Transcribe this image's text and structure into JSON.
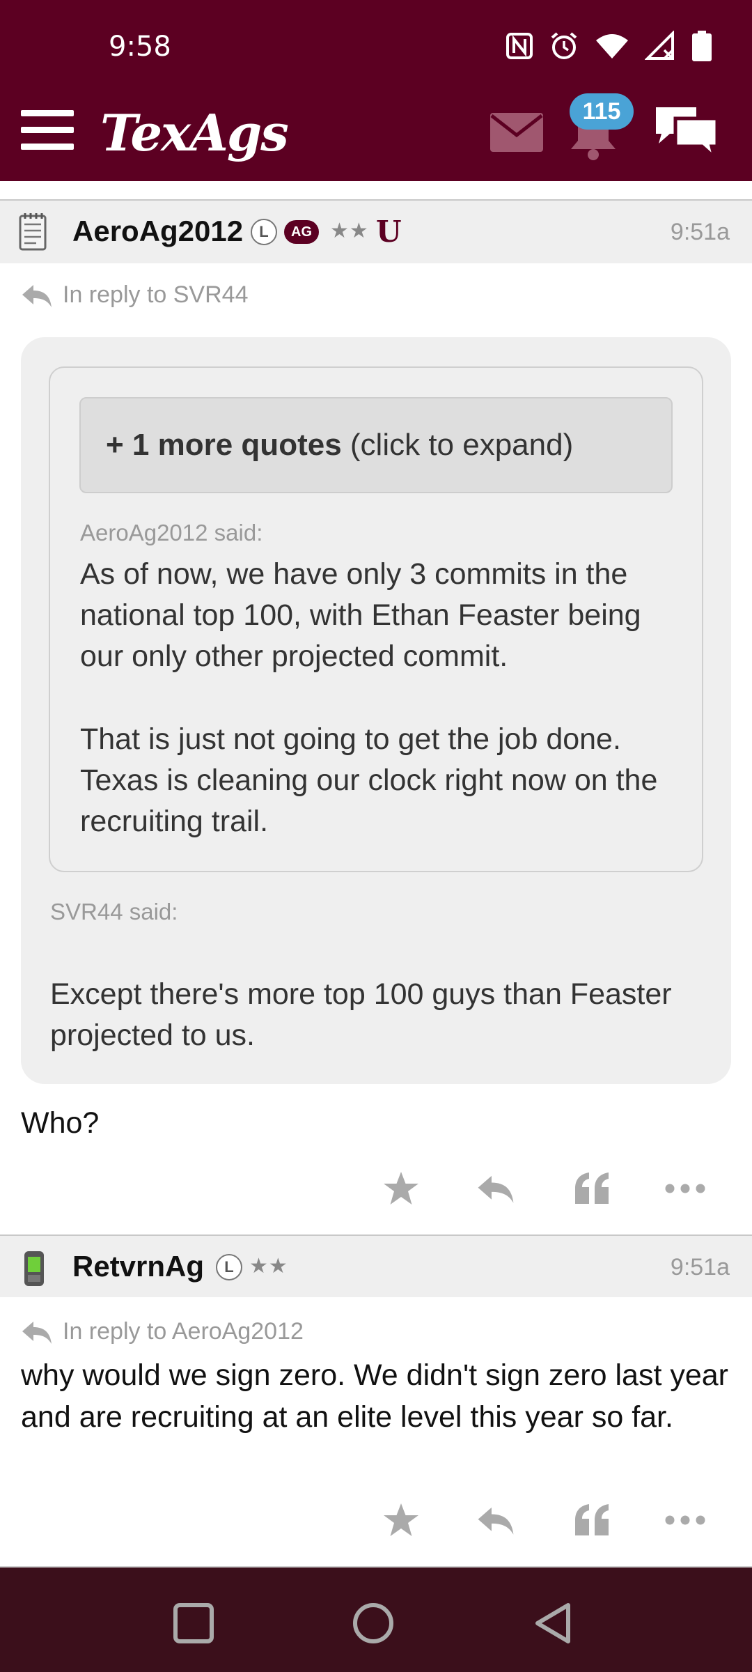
{
  "status_bar": {
    "time": "9:58"
  },
  "header": {
    "brand": "TexAgs",
    "notification_count": "115"
  },
  "posts": [
    {
      "username": "AeroAg2012",
      "badge_l": "L",
      "badge_ag": "AG",
      "stars": "★★",
      "mark": "U",
      "time": "9:51a",
      "reply_to": "In reply to SVR44",
      "quote": {
        "expand_bold": "+ 1 more quotes",
        "expand_rest": " (click to expand)",
        "nested_author": "AeroAg2012 said:",
        "nested_para1": "As of now, we have only 3 commits in the national top 100, with Ethan Feaster being our only other projected commit.",
        "nested_para2": "That is just not going to get the job done. Texas is cleaning our clock right now on the recruiting trail.",
        "author": "SVR44 said:",
        "text": "Except there's more top 100 guys than Feaster projected to us."
      },
      "body": "Who?"
    },
    {
      "username": "RetvrnAg",
      "badge_l": "L",
      "stars": "★★",
      "time": "9:51a",
      "reply_to": "In reply to AeroAg2012",
      "body": "why would we sign zero. We didn't sign zero last year and are recruiting at an elite level this year so far."
    }
  ],
  "colors": {
    "brand": "#5c0022",
    "navbar": "#3b0f1b",
    "badge": "#4aa3d6",
    "icon_gray": "#aaaaaa"
  }
}
